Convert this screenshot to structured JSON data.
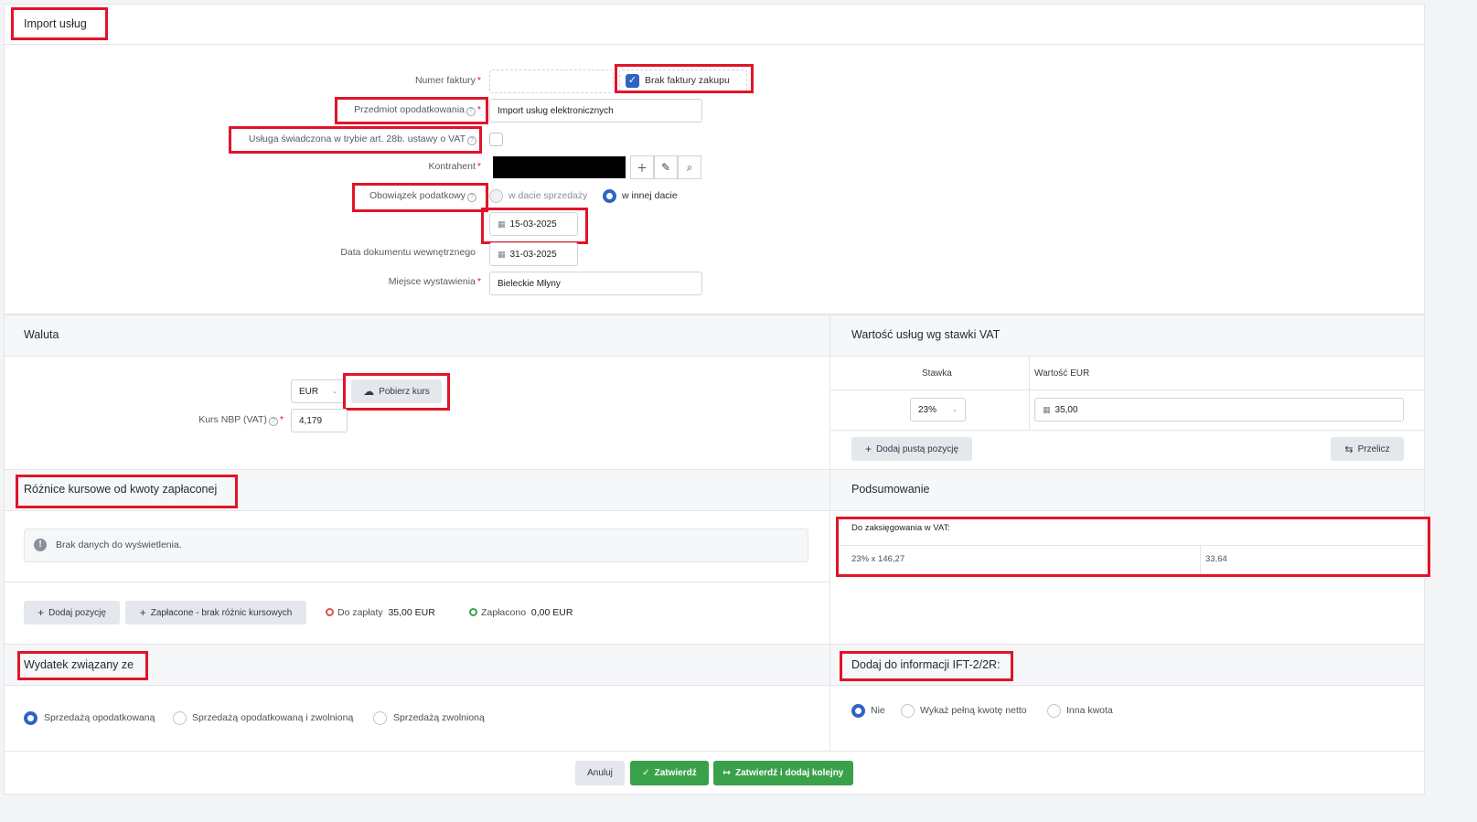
{
  "header": {
    "title": "Import usług"
  },
  "form": {
    "invoice_number": {
      "label": "Numer faktury",
      "value": ""
    },
    "no_invoice": {
      "label": "Brak faktury zakupu",
      "checked": true
    },
    "subject": {
      "label": "Przedmiot opodatkowania",
      "value": "Import usług elektronicznych"
    },
    "art28b": {
      "label": "Usługa świadczona w trybie art. 28b. ustawy o VAT",
      "checked": false
    },
    "contractor": {
      "label": "Kontrahent"
    },
    "tax_obligation": {
      "label": "Obowiązek podatkowy",
      "option1": "w dacie sprzedaży",
      "option2": "w innej dacie",
      "selected": "option2"
    },
    "tax_date": {
      "value": "15-03-2025"
    },
    "internal_date": {
      "label": "Data dokumentu wewnętrznego",
      "value": "31-03-2025"
    },
    "place": {
      "label": "Miejsce wystawienia",
      "value": "Bieleckie Młyny"
    }
  },
  "currency": {
    "title": "Waluta",
    "code": "EUR",
    "fetch_label": "Pobierz kurs",
    "rate_label": "Kurs NBP (VAT)",
    "rate_value": "4,179"
  },
  "vat_values": {
    "title": "Wartość usług wg stawki VAT",
    "col_rate": "Stawka",
    "col_value": "Wartość EUR",
    "rate": "23%",
    "value": "35,00",
    "add_label": "Dodaj pustą pozycję",
    "recalc_label": "Przelicz"
  },
  "fx_diff": {
    "title": "Różnice kursowe od kwoty zapłaconej",
    "empty": "Brak danych do wyświetlenia.",
    "add_label": "Dodaj pozycję",
    "paid_label": "Zapłacone - brak różnic kursowych",
    "to_pay_label": "Do zapłaty",
    "to_pay_value": "35,00 EUR",
    "paid_status_label": "Zapłacono",
    "paid_status_value": "0,00 EUR"
  },
  "summary": {
    "title": "Podsumowanie",
    "heading": "Do zaksięgowania w VAT:",
    "row_label": "23% x 146,27",
    "row_value": "33,64"
  },
  "expense": {
    "title": "Wydatek związany ze",
    "opt1": "Sprzedażą opodatkowaną",
    "opt2": "Sprzedażą opodatkowaną i zwolnioną",
    "opt3": "Sprzedażą zwolnioną",
    "selected": "opt1"
  },
  "ift": {
    "title": "Dodaj do informacji IFT-2/2R:",
    "opt1": "Nie",
    "opt2": "Wykaż pełną kwotę netto",
    "opt3": "Inna kwota",
    "selected": "opt1"
  },
  "footer": {
    "cancel": "Anuluj",
    "confirm": "Zatwierdź",
    "confirm_next": "Zatwierdź i dodaj kolejny"
  },
  "colors": {
    "accent": "#2f63c4",
    "success": "#3aa14b",
    "highlight": "#e0142a"
  }
}
